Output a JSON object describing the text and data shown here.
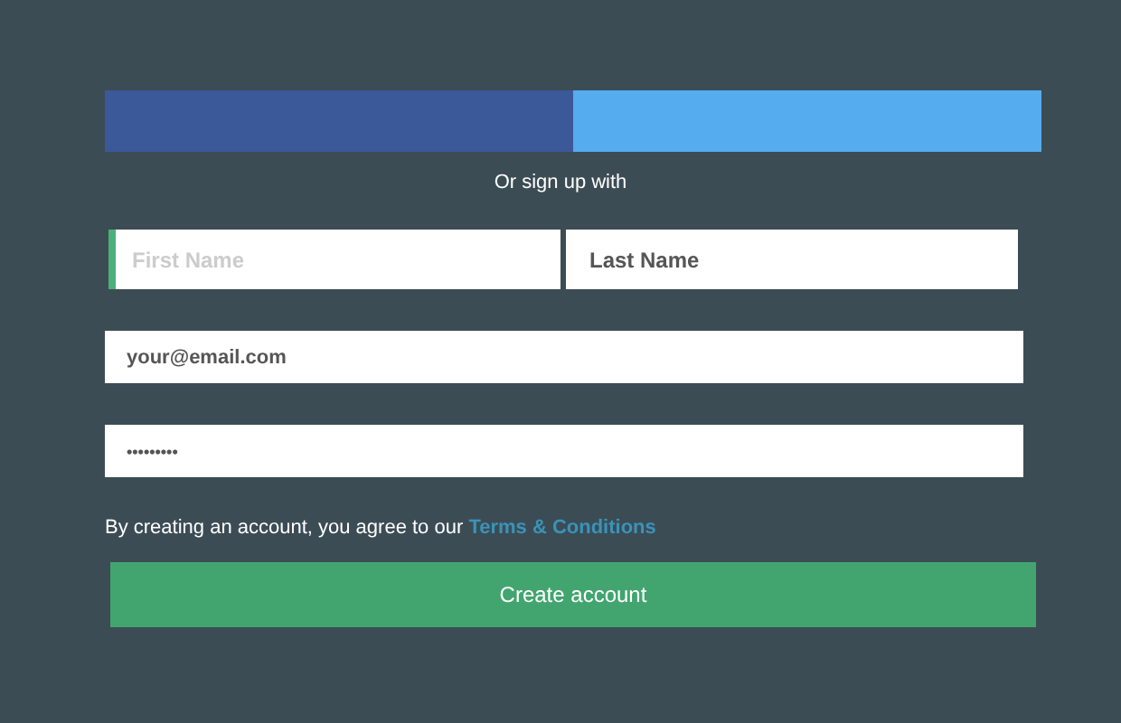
{
  "social_buttons": [
    {
      "color": "#3b5998"
    },
    {
      "color": "#55acee"
    }
  ],
  "divider_text": "Or sign up with",
  "name_fields": [
    {
      "placeholder": "First Name",
      "focused": true
    },
    {
      "value": "Last Name",
      "focused": false
    }
  ],
  "email_field": {
    "value": "your@email.com"
  },
  "password_field": {
    "value": "•••••••••"
  },
  "terms": {
    "text": "By creating an account, you agree to our",
    "link": "Terms & Conditions"
  },
  "submit_button": "Create account"
}
